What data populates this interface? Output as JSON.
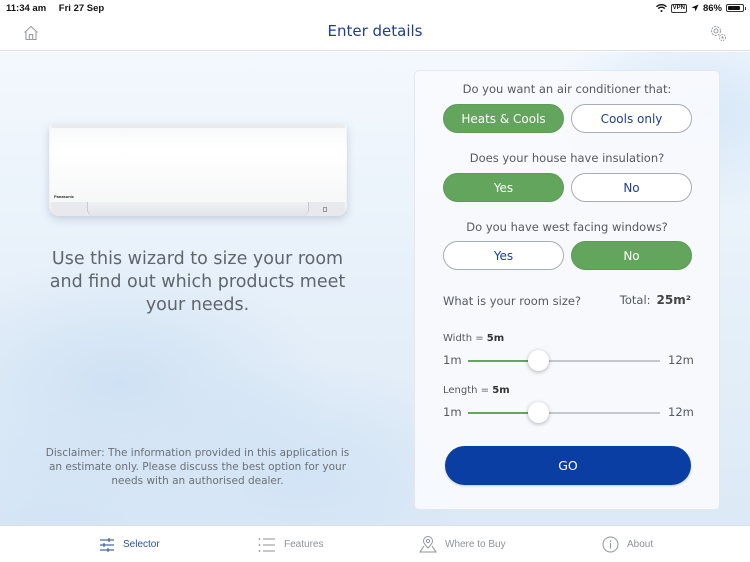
{
  "status_bar": {
    "time": "11:34 am",
    "date": "Fri 27 Sep",
    "vpn_label": "VPN",
    "battery_percent": "86%",
    "battery_level": 0.86,
    "icons": [
      "wifi-icon",
      "vpn-icon",
      "location-icon",
      "battery-icon"
    ]
  },
  "nav": {
    "title": "Enter details",
    "left_icon": "home-icon",
    "right_icon": "settings-icon"
  },
  "left": {
    "intro": "Use this wizard to size your room and find out which products meet your needs.",
    "disclaimer": "Disclaimer: The information provided in this application is an estimate only. Please discuss the best option for your needs with an authorised dealer.",
    "product_brand": "Panasonic"
  },
  "form": {
    "questions": [
      {
        "text": "Do you want an air conditioner that:",
        "options": [
          {
            "label": "Heats & Cools",
            "selected": true
          },
          {
            "label": "Cools only",
            "selected": false
          }
        ]
      },
      {
        "text": "Does your house have insulation?",
        "options": [
          {
            "label": "Yes",
            "selected": true
          },
          {
            "label": "No",
            "selected": false
          }
        ]
      },
      {
        "text": "Do you have west facing windows?",
        "options": [
          {
            "label": "Yes",
            "selected": false
          },
          {
            "label": "No",
            "selected": true
          }
        ]
      }
    ],
    "room_size": {
      "label": "What is your room size?",
      "total_label": "Total:",
      "total_value": "25m²"
    },
    "sliders": [
      {
        "label": "Width = ",
        "value_text": "5m",
        "min_label": "1m",
        "max_label": "12m",
        "min": 1,
        "max": 12,
        "value": 5
      },
      {
        "label": "Length = ",
        "value_text": "5m",
        "min_label": "1m",
        "max_label": "12m",
        "min": 1,
        "max": 12,
        "value": 5
      }
    ],
    "go_label": "GO"
  },
  "tabs": [
    {
      "label": "Selector",
      "icon": "sliders-icon",
      "active": true
    },
    {
      "label": "Features",
      "icon": "list-icon",
      "active": false
    },
    {
      "label": "Where to Buy",
      "icon": "map-pin-icon",
      "active": false
    },
    {
      "label": "About",
      "icon": "info-icon",
      "active": false
    }
  ],
  "colors": {
    "accent_blue": "#0a3ea3",
    "title_blue": "#1f3f8f",
    "selected_green": "#63a55c",
    "tab_active": "#2e52a3"
  }
}
